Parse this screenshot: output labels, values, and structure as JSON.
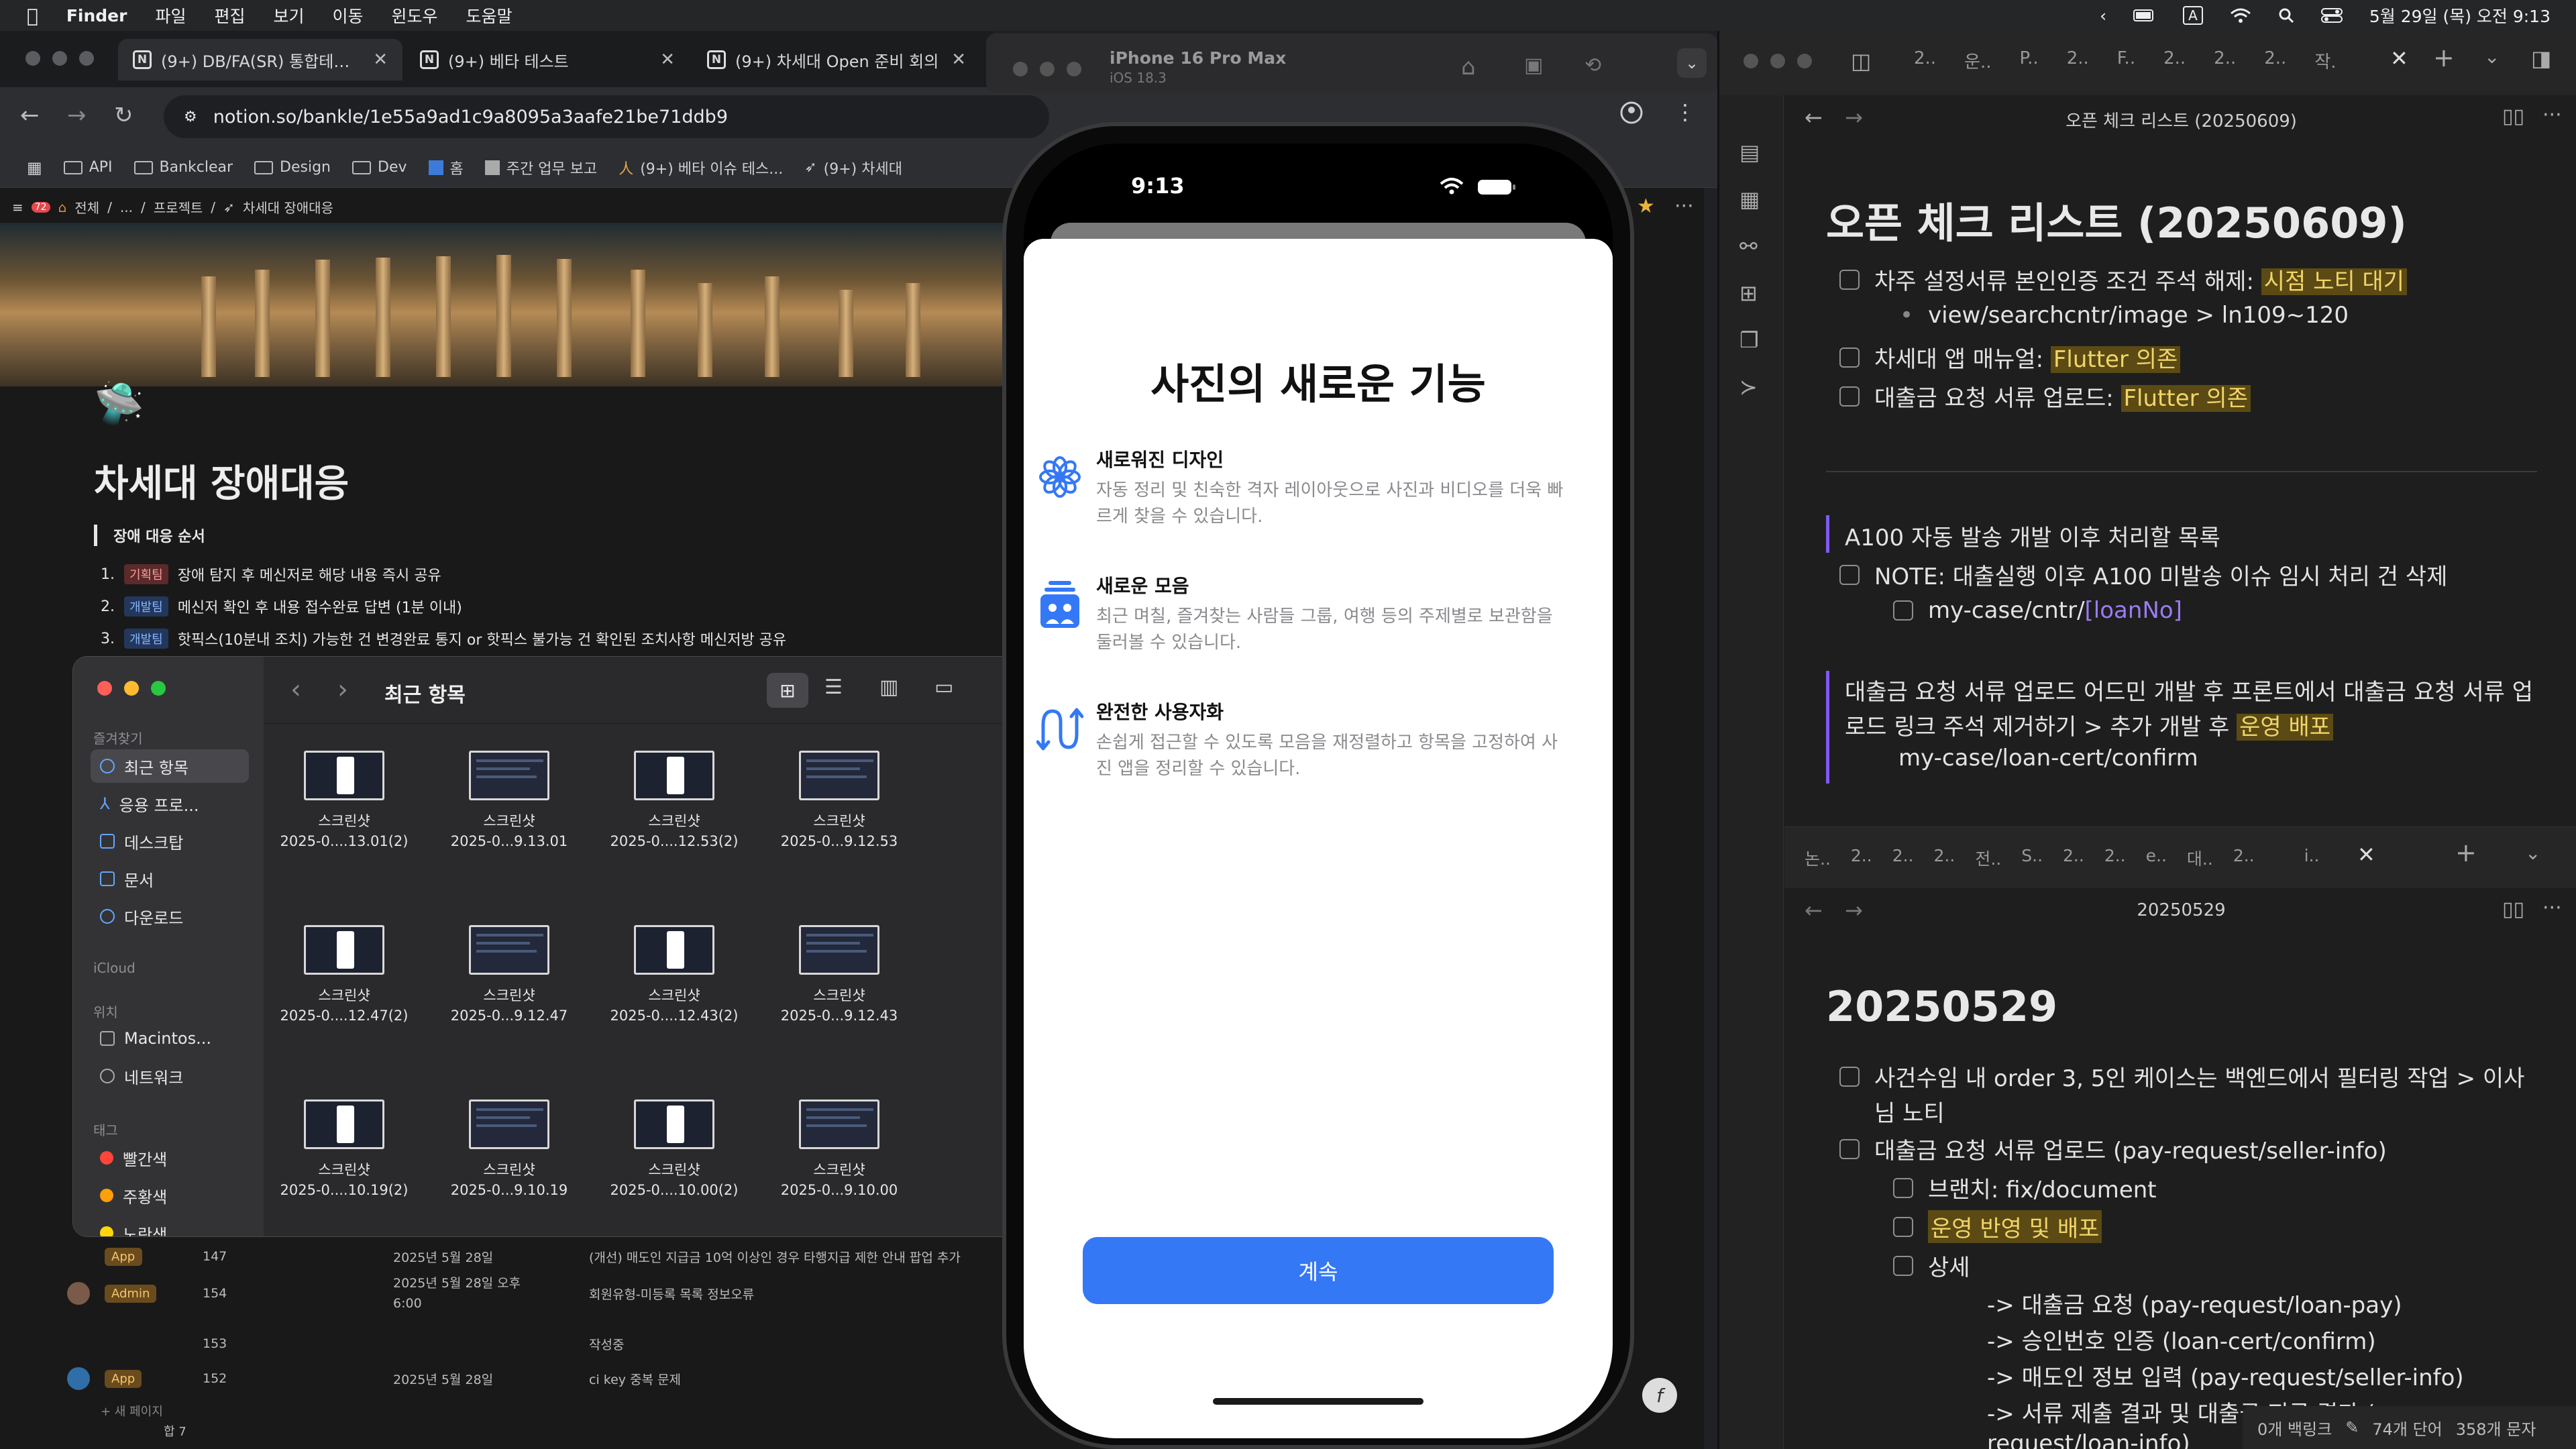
{
  "menubar": {
    "app": "Finder",
    "menus": [
      "파일",
      "편집",
      "보기",
      "이동",
      "윈도우",
      "도움말"
    ],
    "datetime": "5월 29일 (목) 오전 9:13",
    "input_mode": "A"
  },
  "chrome": {
    "tabs": [
      {
        "title": "(9+) DB/FA(SR) 통합테스트",
        "active": true
      },
      {
        "title": "(9+) 베타 테스트",
        "active": false
      },
      {
        "title": "(9+) 차세대 Open 준비 회의",
        "active": false
      }
    ],
    "url": "notion.so/bankle/1e55a9ad1c9a8095a3aafe21be71ddb9",
    "bookmarks": [
      "API",
      "Bankclear",
      "Design",
      "Dev",
      "홈",
      "주간 업무 보고",
      "(9+) 베타 이슈 테스...",
      "(9+) 차세대"
    ]
  },
  "notion": {
    "breadcrumb": [
      "전체",
      "...",
      "프로젝트",
      "차세대 장애대응"
    ],
    "notif_count": "72",
    "title": "차세대 장애대응",
    "quote": "장애 대응 순서",
    "steps": [
      {
        "num": "1.",
        "tag": "기획팀",
        "text": "장애 탐지 후 메신저로 해당 내용 즉시 공유"
      },
      {
        "num": "2.",
        "tag": "개발팀",
        "text": "메신저 확인 후 내용 접수완료 답변 (1분 이내)"
      },
      {
        "num": "3.",
        "tag": "개발팀",
        "text": "핫픽스(10분내 조치) 가능한 건 변경완료 통지 or 핫픽스 불가능 건 확인된 조치사항 메신저방 공유"
      }
    ],
    "rows": [
      {
        "badge": "App",
        "id": "147",
        "date": "2025년 5월 28일",
        "desc": "(개선) 매도인 지급금 10억 이상인 경우 타행지급 제한 안내 팝업 추가"
      },
      {
        "badge": "Admin",
        "id": "154",
        "date": "2025년 5월 28일 오후 6:00",
        "desc": "회원유형-미등록 목록 정보오류"
      },
      {
        "badge": "",
        "id": "153",
        "date": "",
        "desc": "작성중"
      },
      {
        "badge": "App",
        "id": "152",
        "date": "2025년 5월 28일",
        "desc": "ci key 중복 문제"
      }
    ],
    "new_page": "+ 새 페이지",
    "count_label": "합 7"
  },
  "finder": {
    "title": "최근 항목",
    "sidebar": {
      "favorites_label": "즐겨찾기",
      "favorites": [
        "최근 항목",
        "응용 프로...",
        "데스크탑",
        "문서",
        "다운로드"
      ],
      "icloud_label": "iCloud",
      "locations_label": "위치",
      "locations": [
        "Macintos...",
        "네트워크"
      ],
      "tags_label": "태그",
      "tags": [
        {
          "name": "빨간색",
          "color": "#ff453a"
        },
        {
          "name": "주황색",
          "color": "#ff9f0a"
        },
        {
          "name": "노란색",
          "color": "#ffd60a"
        }
      ]
    },
    "files": [
      {
        "name": "스크린샷",
        "date": "2025-0....13.01(2)"
      },
      {
        "name": "스크린샷",
        "date": "2025-0...9.13.01"
      },
      {
        "name": "스크린샷",
        "date": "2025-0....12.53(2)"
      },
      {
        "name": "스크린샷",
        "date": "2025-0...9.12.53"
      },
      {
        "name": "스크린샷",
        "date": "2025-0....12.47(2)"
      },
      {
        "name": "스크린샷",
        "date": "2025-0...9.12.47"
      },
      {
        "name": "스크린샷",
        "date": "2025-0....12.43(2)"
      },
      {
        "name": "스크린샷",
        "date": "2025-0...9.12.43"
      },
      {
        "name": "스크린샷",
        "date": "2025-0....10.19(2)"
      },
      {
        "name": "스크린샷",
        "date": "2025-0...9.10.19"
      },
      {
        "name": "스크린샷",
        "date": "2025-0....10.00(2)"
      },
      {
        "name": "스크린샷",
        "date": "2025-0...9.10.00"
      }
    ]
  },
  "simulator": {
    "device": "iPhone 16 Pro Max",
    "os": "iOS 18.3",
    "time": "9:13",
    "sheet_title": "사진의 새로운 기능",
    "features": [
      {
        "icon": "flower-icon",
        "title": "새로워진 디자인",
        "desc": "자동 정리 및 친숙한 격자 레이아웃으로 사진과 비디오를 더욱 빠르게 찾을 수 있습니다."
      },
      {
        "icon": "collection-icon",
        "title": "새로운 모음",
        "desc": "최근 며칠, 즐겨찾는 사람들 그룹, 여행 등의 주제별로 보관함을 둘러볼 수 있습니다."
      },
      {
        "icon": "reorder-icon",
        "title": "완전한 사용자화",
        "desc": "손쉽게 접근할 수 있도록 모음을 재정렬하고 항목을 고정하여 사진 앱을 정리할 수 있습니다."
      }
    ],
    "continue_label": "계속",
    "accent": "#3478f6"
  },
  "obsidian": {
    "tabs_top": [
      "2..",
      "운..",
      "P..",
      "2..",
      "F..",
      "2..",
      "2..",
      "2..",
      "작."
    ],
    "tabs_bottom": [
      "논..",
      "2..",
      "2..",
      "2..",
      "전..",
      "S..",
      "2..",
      "2..",
      "e..",
      "대..",
      "2..",
      "i.."
    ],
    "pane1": {
      "header": "오픈 체크 리스트 (20250609)",
      "title": "오픈 체크 리스트 (20250609)",
      "items": [
        {
          "text": "차주 설정서류 본인인증 조건 주석 해제: ",
          "hl": "시점 노티 대기"
        },
        {
          "sub": "view/searchcntr/image > ln109~120"
        },
        {
          "text": "차세대 앱 매뉴얼: ",
          "hl": "Flutter 의존"
        },
        {
          "text": "대출금 요청 서류 업로드: ",
          "hl": "Flutter 의존"
        }
      ],
      "quote1": "A100 자동 발송 개발 이후 처리할 목록",
      "note": "NOTE: 대출실행 이후 A100 미발송 이슈 임시 처리 건 삭제",
      "note_path_prefix": "my-case/cntr/",
      "note_path_param": "[loanNo]",
      "quote2_a": "대출금 요청 서류 업로드 어드민 개발 후 프론트에서 대출금 요청 서류 업",
      "quote2_b": "로드 링크 주석 제거하기 > 추가 개발 후 ",
      "quote2_hl": "운영 배포",
      "quote2_path": "my-case/loan-cert/confirm"
    },
    "pane2": {
      "header": "20250529",
      "title": "20250529",
      "item1_a": "사건수임 내 order 3, 5인 케이스는 백엔드에서 필터링 작업 > 이사",
      "item1_b": "님 노티",
      "item2": "대출금 요청 서류 업로드 (pay-request/seller-info)",
      "branch": "브랜치: fix/document",
      "deploy": "운영 반영 및 배포",
      "detail": "상세",
      "flows": [
        "-> 대출금 요청 (pay-request/loan-pay)",
        "-> 승인번호 인증 (loan-cert/confirm)",
        "-> 매도인 정보 입력 (pay-request/seller-info)",
        "-> 서류 제출 결과 및 대출금 지급 결과 (pay-",
        "request/loan-info)"
      ]
    },
    "status": {
      "backlinks": "0개 백링크",
      "words": "74개 단어",
      "chars": "358개 문자"
    }
  }
}
